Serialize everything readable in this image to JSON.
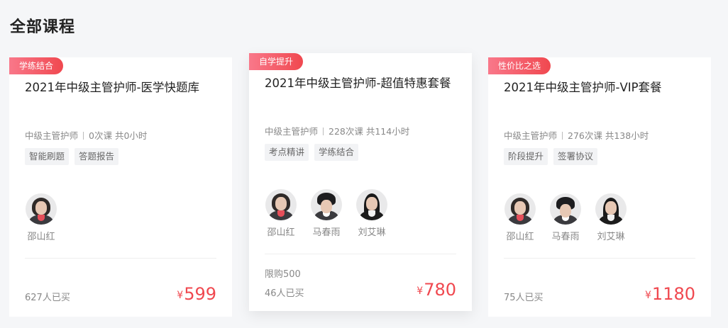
{
  "page": {
    "title": "全部课程"
  },
  "courses": [
    {
      "tag": "学练结合",
      "title": "2021年中级主管护师-医学快题库",
      "category": "中级主管护师",
      "stats": "0次课 共0小时",
      "features": [
        "智能刷题",
        "答题报告"
      ],
      "teachers": [
        "邵山红"
      ],
      "limit": "",
      "buyers": "627人已买",
      "currency": "¥",
      "price": "599"
    },
    {
      "tag": "自学提升",
      "title": "2021年中级主管护师-超值特惠套餐",
      "category": "中级主管护师",
      "stats": "228次课 共114小时",
      "features": [
        "考点精讲",
        "学练结合"
      ],
      "teachers": [
        "邵山红",
        "马春雨",
        "刘艾琳"
      ],
      "limit": "限购500",
      "buyers": "46人已买",
      "currency": "¥",
      "price": "780"
    },
    {
      "tag": "性价比之选",
      "title": "2021年中级主管护师-VIP套餐",
      "category": "中级主管护师",
      "stats": "276次课 共138小时",
      "features": [
        "阶段提升",
        "签署协议"
      ],
      "teachers": [
        "邵山红",
        "马春雨",
        "刘艾琳"
      ],
      "limit": "",
      "buyers": "75人已买",
      "currency": "¥",
      "price": "1180"
    }
  ],
  "colors": {
    "accent": "#f0484f",
    "tag_gradient_start": "#f9788a"
  }
}
